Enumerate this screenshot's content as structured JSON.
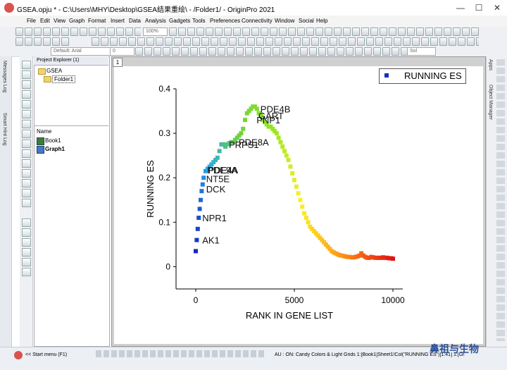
{
  "window": {
    "title": "GSEA.opju * - C:\\Users\\MHY\\Desktop\\GSEA结果重绘\\ - /Folder1/ - OriginPro 2021",
    "min_glyph": "—",
    "max_glyph": "☐",
    "close_glyph": "✕"
  },
  "menu": [
    "File",
    "Edit",
    "View",
    "Graph",
    "Format",
    "Insert",
    "Data",
    "Analysis",
    "Gadgets",
    "Tools",
    "Preferences",
    "Connectivity",
    "Window",
    "Social",
    "Help"
  ],
  "toolbar": {
    "zoom": "100%",
    "font": "Default: Arial",
    "size": "0",
    "line_label": "Sol"
  },
  "left_tabs": {
    "messages": "Messages Log",
    "smart_hint": "Smart Hint Log"
  },
  "right_tabs": {
    "apps": "Apps",
    "object_manager": "Object Manager"
  },
  "project_explorer": {
    "title": "Project Explorer (1)",
    "root": "GSEA",
    "folder": "Folder1",
    "list_header": "Name",
    "items": [
      "Book1",
      "Graph1"
    ]
  },
  "graph": {
    "layer_number": "1",
    "legend_label": "RUNNING ES"
  },
  "status": {
    "start_menu": "<< Start menu (F1)",
    "info": "AU : ON: Candy Colors & Light Grids 1:[Book1]Sheet1!Col(\"RUNNING ES\")[1:41] 1:[Graph1]1!1",
    "watermark": "鼻祖与生物"
  },
  "chart_data": {
    "type": "scatter",
    "xlabel": "RANK IN GENE LIST",
    "ylabel": "RUNNING ES",
    "xlim": [
      -1000,
      10500
    ],
    "ylim": [
      -0.05,
      0.4
    ],
    "xticks": [
      0,
      5000,
      10000
    ],
    "yticks": [
      0,
      0.1,
      0.2,
      0.3,
      0.4
    ],
    "xtick_labels": [
      "0",
      "5000",
      "10000"
    ],
    "ytick_labels": [
      "0",
      "0.1",
      "0.2",
      "0.3",
      "0.4"
    ],
    "legend": "top-right",
    "series": [
      {
        "name": "RUNNING ES",
        "x": [
          0,
          50,
          100,
          150,
          200,
          250,
          300,
          350,
          400,
          500,
          600,
          700,
          800,
          900,
          1000,
          1100,
          1200,
          1300,
          1400,
          1500,
          1600,
          1700,
          1800,
          1900,
          2000,
          2100,
          2200,
          2300,
          2400,
          2500,
          2600,
          2700,
          2800,
          2900,
          3000,
          3100,
          3200,
          3300,
          3400,
          3500,
          3600,
          3700,
          3800,
          3900,
          4000,
          4100,
          4200,
          4300,
          4400,
          4500,
          4600,
          4700,
          4800,
          4900,
          5000,
          5100,
          5200,
          5300,
          5400,
          5500,
          5600,
          5700,
          5800,
          5900,
          6000,
          6100,
          6200,
          6300,
          6400,
          6500,
          6600,
          6700,
          6800,
          6900,
          7000,
          7100,
          7200,
          7300,
          7400,
          7500,
          7600,
          7700,
          7800,
          7900,
          8000,
          8100,
          8200,
          8300,
          8400,
          8500,
          8600,
          8700,
          8800,
          8900,
          9000,
          9100,
          9200,
          9300,
          9400,
          9500,
          9600,
          9700,
          9800,
          9900,
          10000
        ],
        "y": [
          0.035,
          0.06,
          0.085,
          0.11,
          0.13,
          0.15,
          0.17,
          0.185,
          0.2,
          0.215,
          0.22,
          0.225,
          0.23,
          0.235,
          0.24,
          0.245,
          0.26,
          0.275,
          0.275,
          0.27,
          0.275,
          0.278,
          0.28,
          0.28,
          0.285,
          0.29,
          0.295,
          0.3,
          0.31,
          0.33,
          0.345,
          0.35,
          0.355,
          0.36,
          0.36,
          0.355,
          0.345,
          0.34,
          0.33,
          0.325,
          0.32,
          0.315,
          0.315,
          0.31,
          0.305,
          0.3,
          0.29,
          0.28,
          0.27,
          0.26,
          0.25,
          0.24,
          0.225,
          0.21,
          0.195,
          0.18,
          0.165,
          0.15,
          0.135,
          0.12,
          0.11,
          0.1,
          0.09,
          0.085,
          0.08,
          0.075,
          0.07,
          0.065,
          0.06,
          0.055,
          0.05,
          0.045,
          0.04,
          0.035,
          0.032,
          0.03,
          0.028,
          0.026,
          0.025,
          0.024,
          0.023,
          0.022,
          0.022,
          0.021,
          0.021,
          0.022,
          0.023,
          0.025,
          0.03,
          0.025,
          0.022,
          0.02,
          0.02,
          0.022,
          0.021,
          0.02,
          0.02,
          0.02,
          0.02,
          0.021,
          0.02,
          0.02,
          0.019,
          0.019,
          0.018
        ]
      }
    ],
    "annotations": [
      {
        "text": "AK1",
        "x": 150,
        "y": 0.06
      },
      {
        "text": "NPR1",
        "x": 150,
        "y": 0.11
      },
      {
        "text": "DCK",
        "x": 350,
        "y": 0.175
      },
      {
        "text": "NT5E",
        "x": 350,
        "y": 0.198
      },
      {
        "text": "PDE9A",
        "x": 400,
        "y": 0.218
      },
      {
        "text": "PDE4A",
        "x": 450,
        "y": 0.218
      },
      {
        "text": "PRPS1",
        "x": 1500,
        "y": 0.275
      },
      {
        "text": "PDE8A",
        "x": 2000,
        "y": 0.28
      },
      {
        "text": "PDE4B",
        "x": 3100,
        "y": 0.355
      },
      {
        "text": "GART",
        "x": 3000,
        "y": 0.34
      },
      {
        "text": "PNP1",
        "x": 2900,
        "y": 0.33
      }
    ]
  }
}
